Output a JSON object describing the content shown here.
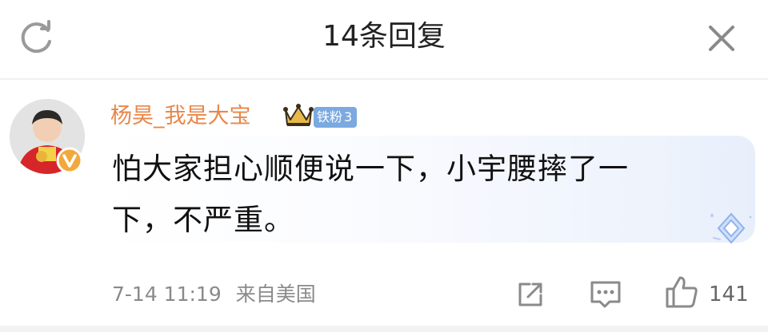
{
  "header": {
    "title": "14条回复",
    "refresh_icon": "refresh-icon",
    "close_icon": "close-icon"
  },
  "comment": {
    "username": "杨昊_我是大宝",
    "fan_badge": {
      "label": "铁粉",
      "level": "3"
    },
    "text_line1": "怕大家担心顺便说一下，小宇腰摔了一",
    "text_line2": "下，不严重。",
    "timestamp": "7-14 11:19",
    "source": "来自美国",
    "like_count": "141"
  },
  "colors": {
    "username": "#e8874a",
    "fan_badge_bg": "#7ba9e0",
    "verified_badge": "#f2a93b",
    "meta_text": "#8a8a8a"
  },
  "icons": {
    "crown": "crown-icon",
    "verified": "verified-badge-icon",
    "diamond": "diamond-icon",
    "share": "share-icon",
    "comment": "comment-icon",
    "like": "thumbs-up-icon"
  }
}
